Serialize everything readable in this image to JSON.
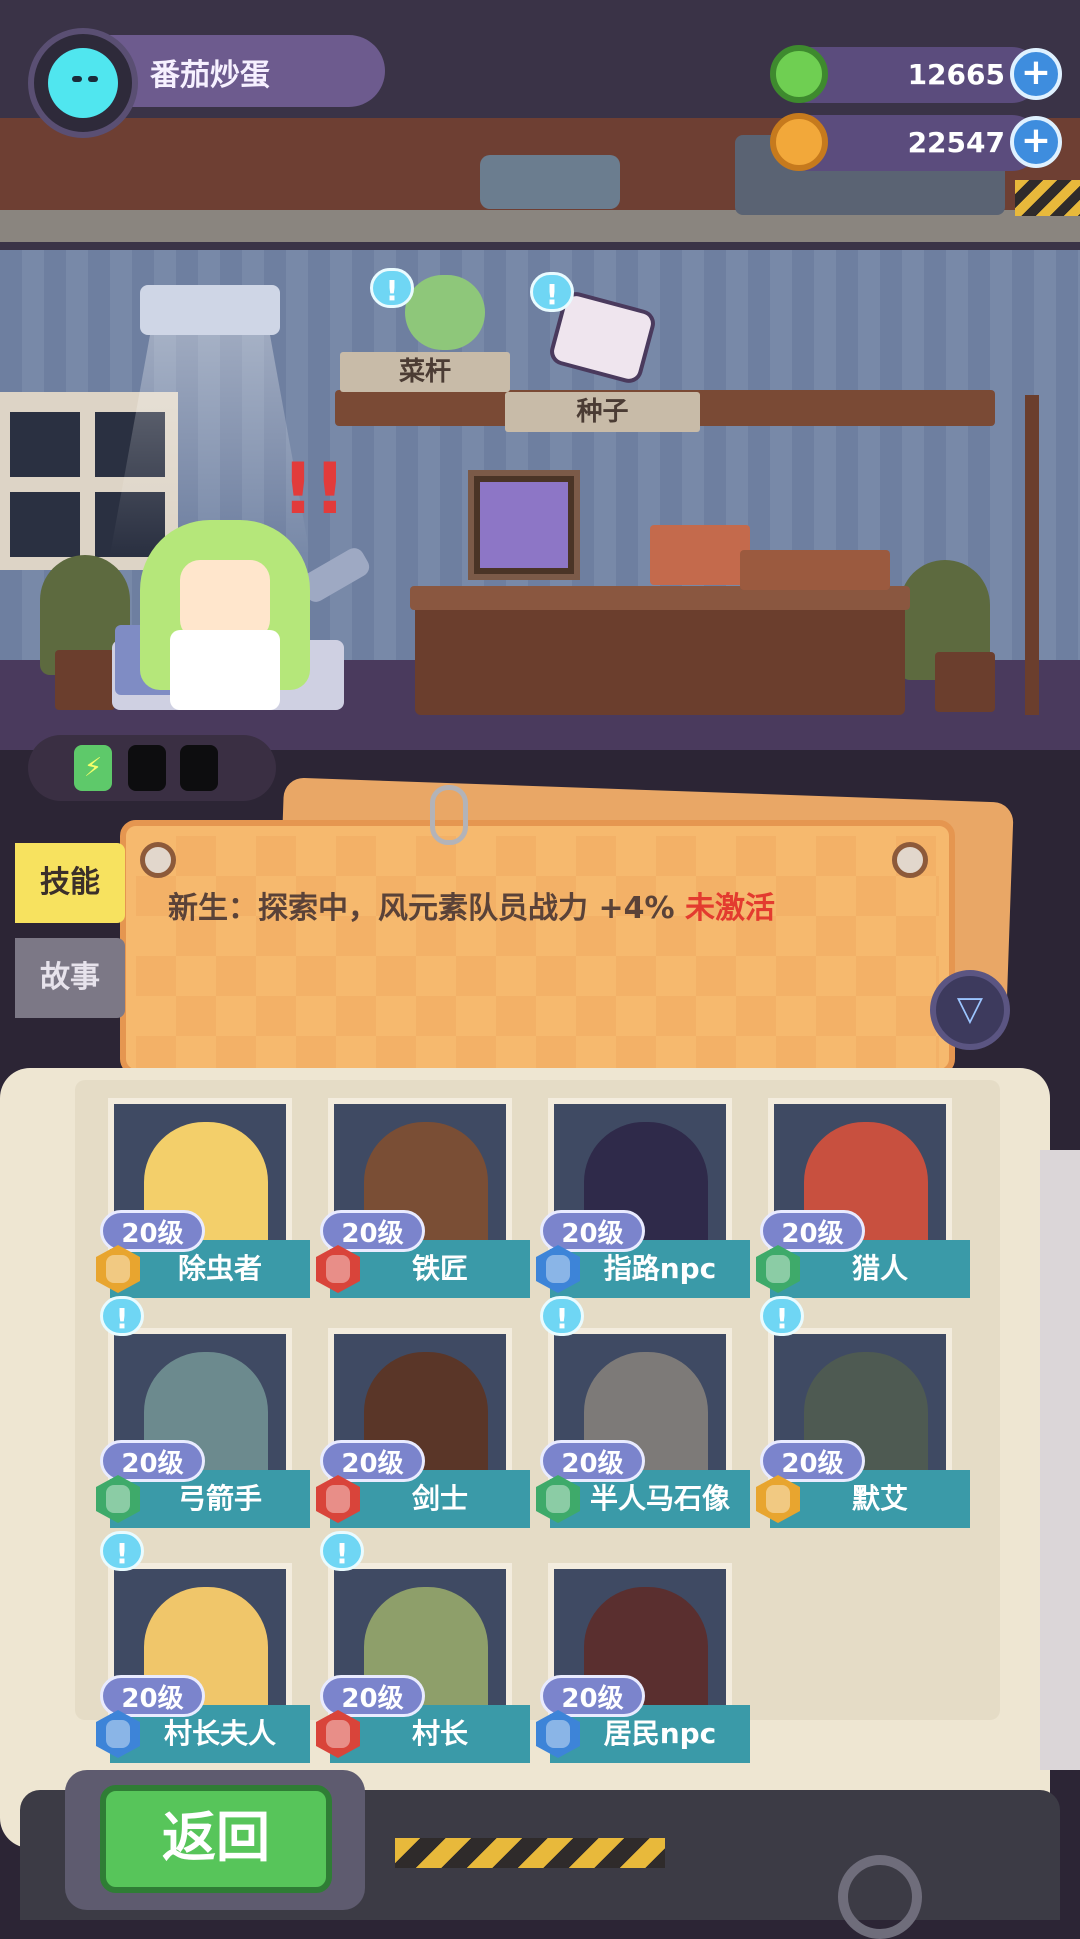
{
  "player": {
    "name": "番茄炒蛋"
  },
  "currencies": [
    {
      "icon": "donut-icon",
      "value": "12665",
      "color": "#6fcf52"
    },
    {
      "icon": "planet-coin-icon",
      "value": "22547",
      "color": "#f2a83a"
    }
  ],
  "room": {
    "tags": [
      "菜杆",
      "种子"
    ],
    "exclaim": "!!"
  },
  "tabs": [
    {
      "label": "技能",
      "active": true
    },
    {
      "label": "故事",
      "active": false
    }
  ],
  "skill": {
    "text": "新生：探索中，风元素队员战力 +4%",
    "status": "未激活"
  },
  "characters": [
    {
      "name": "除虫者",
      "level": "20级",
      "badge": "#e8a52f",
      "face": "#f3cf6a",
      "alert": false
    },
    {
      "name": "铁匠",
      "level": "20级",
      "badge": "#d9443a",
      "face": "#7a4e35",
      "alert": false
    },
    {
      "name": "指路npc",
      "level": "20级",
      "badge": "#3d84d8",
      "face": "#2f2a4a",
      "alert": false
    },
    {
      "name": "猎人",
      "level": "20级",
      "badge": "#3eaa6a",
      "face": "#c8503f",
      "alert": false
    },
    {
      "name": "弓箭手",
      "level": "20级",
      "badge": "#3eaa6a",
      "face": "#6c8a8e",
      "alert": true
    },
    {
      "name": "剑士",
      "level": "20级",
      "badge": "#d9443a",
      "face": "#5a3628",
      "alert": false
    },
    {
      "name": "半人马石像",
      "level": "20级",
      "badge": "#3eaa6a",
      "face": "#7d7a78",
      "alert": true
    },
    {
      "name": "默艾",
      "level": "20级",
      "badge": "#e8a52f",
      "face": "#4e5a52",
      "alert": true
    },
    {
      "name": "村长夫人",
      "level": "20级",
      "badge": "#3d84d8",
      "face": "#f0c66a",
      "alert": true
    },
    {
      "name": "村长",
      "level": "20级",
      "badge": "#d9443a",
      "face": "#8e9f6a",
      "alert": true
    },
    {
      "name": "居民npc",
      "level": "20级",
      "badge": "#3d84d8",
      "face": "#5a2f2f",
      "alert": false
    }
  ],
  "alert_symbol": "!",
  "filter_symbol": "▽",
  "plus_symbol": "+",
  "back_button": "返回"
}
